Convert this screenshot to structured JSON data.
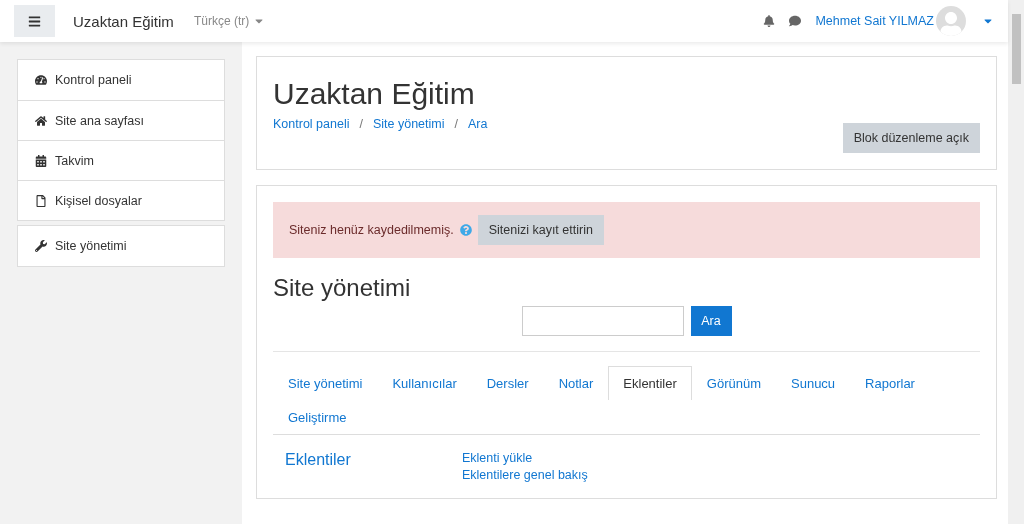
{
  "navbar": {
    "brand": "Uzaktan Eğitim",
    "language": "Türkçe (tr)",
    "user": "Mehmet Sait YILMAZ"
  },
  "sidebar": {
    "groups": [
      [
        {
          "label": "Kontrol paneli",
          "kind": "dashboard"
        },
        {
          "label": "Site ana sayfası",
          "kind": "home"
        },
        {
          "label": "Takvim",
          "kind": "calendar"
        },
        {
          "label": "Kişisel dosyalar",
          "kind": "file"
        }
      ],
      [
        {
          "label": "Site yönetimi",
          "kind": "wrench"
        }
      ]
    ]
  },
  "header": {
    "title": "Uzaktan Eğitim",
    "breadcrumb": [
      "Kontrol paneli",
      "Site yönetimi",
      "Ara"
    ],
    "breadcrumb_separator": "/",
    "edit_button": "Blok düzenleme açık"
  },
  "alert": {
    "text": "Siteniz henüz kaydedilmemiş.",
    "button": "Sitenizi kayıt ettirin"
  },
  "admin": {
    "heading": "Site yönetimi",
    "search_button": "Ara",
    "tabs": [
      {
        "label": "Site yönetimi",
        "selected": false
      },
      {
        "label": "Kullanıcılar",
        "selected": false
      },
      {
        "label": "Dersler",
        "selected": false
      },
      {
        "label": "Notlar",
        "selected": false
      },
      {
        "label": "Eklentiler",
        "selected": true
      },
      {
        "label": "Görünüm",
        "selected": false
      },
      {
        "label": "Sunucu",
        "selected": false
      },
      {
        "label": "Raporlar",
        "selected": false
      },
      {
        "label": "Geliştirme",
        "selected": false
      }
    ],
    "section": {
      "title": "Eklentiler",
      "links": [
        "Eklenti yükle",
        "Eklentilere genel bakış"
      ]
    }
  }
}
